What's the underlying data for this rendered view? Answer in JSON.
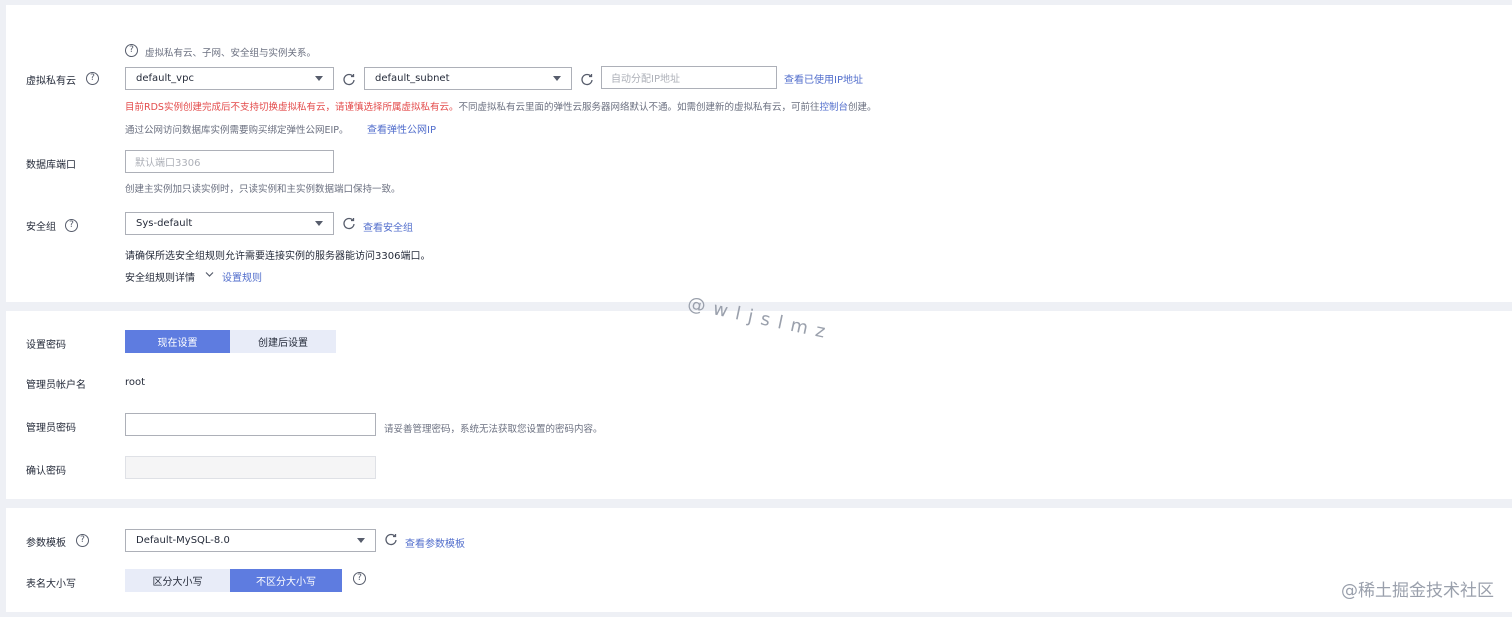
{
  "network": {
    "vpc_hint": "虚拟私有云、子网、安全组与实例关系。",
    "vpc_label": "虚拟私有云",
    "vpc_value": "default_vpc",
    "subnet_value": "default_subnet",
    "ip_placeholder": "自动分配IP地址",
    "view_ip_link": "查看已使用IP地址",
    "warn_red": "目前RDS实例创建完成后不支持切换虚拟私有云，请谨慎选择所属虚拟私有云。",
    "warn_gray": "不同虚拟私有云里面的弹性云服务器网络默认不通。如需创建新的虚拟私有云，可前往",
    "console_link": "控制台",
    "warn_tail": "创建。",
    "eip_hint": "通过公网访问数据库实例需要购买绑定弹性公网EIP。",
    "eip_link": "查看弹性公网IP",
    "port_label": "数据库端口",
    "port_placeholder": "默认端口3306",
    "port_hint": "创建主实例加只读实例时，只读实例和主实例数据端口保持一致。",
    "sg_label": "安全组",
    "sg_value": "Sys-default",
    "sg_view_link": "查看安全组",
    "sg_hint": "请确保所选安全组规则允许需要连接实例的服务器能访问3306端口。",
    "sg_rules_label": "安全组规则详情",
    "sg_set_rules_link": "设置规则"
  },
  "password": {
    "set_label": "设置密码",
    "now_btn": "现在设置",
    "later_btn": "创建后设置",
    "admin_name_label": "管理员帐户名",
    "admin_name_value": "root",
    "admin_pwd_label": "管理员密码",
    "admin_pwd_hint": "请妥善管理密码，系统无法获取您设置的密码内容。",
    "confirm_label": "确认密码"
  },
  "params": {
    "template_label": "参数模板",
    "template_value": "Default-MySQL-8.0",
    "template_view_link": "查看参数模板",
    "case_label": "表名大小写",
    "case_sensitive_btn": "区分大小写",
    "case_insensitive_btn": "不区分大小写"
  },
  "watermark": "@wljslmz",
  "brand_watermark": "@稀土掘金技术社区",
  "colors": {
    "accent": "#5e7ce0",
    "link": "#526ecc",
    "warning": "#e34a4a"
  }
}
